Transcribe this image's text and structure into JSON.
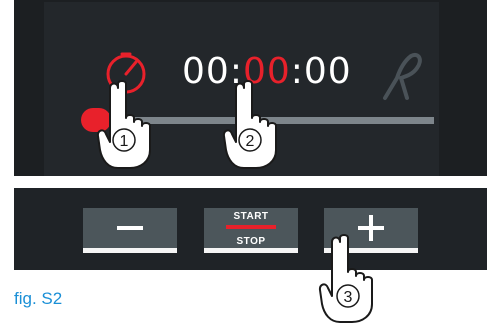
{
  "display": {
    "timer_hours": "00",
    "timer_sep1": ":",
    "timer_minutes": "00",
    "timer_sep2": ":",
    "timer_seconds": "00",
    "active_color": "#e8212b",
    "left_icon": "clock-icon",
    "right_icon": "probe-icon"
  },
  "controls": {
    "minus_icon": "minus-icon",
    "start_label": "START",
    "stop_label": "STOP",
    "plus_icon": "plus-icon"
  },
  "steps": {
    "step1": "1",
    "step2": "2",
    "step3": "3"
  },
  "caption": "fig. S2"
}
